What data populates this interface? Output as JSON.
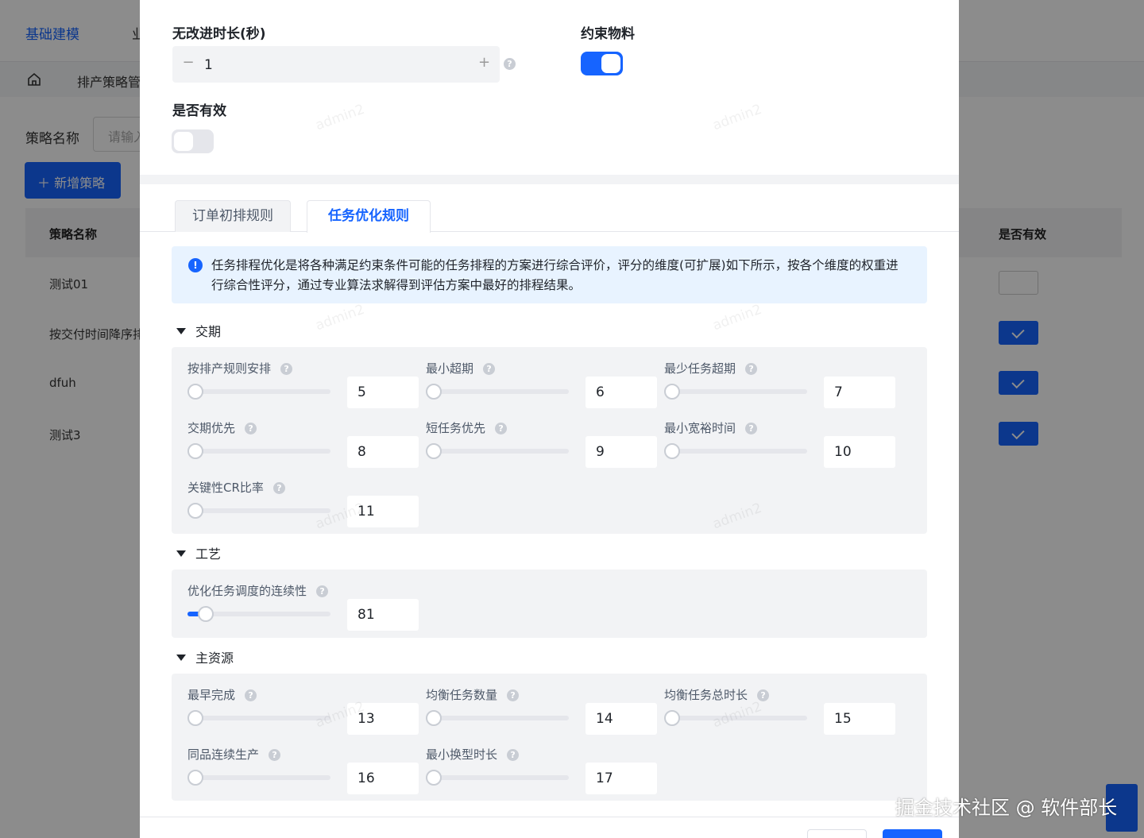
{
  "background": {
    "nav": {
      "first": "基础建模",
      "second": "业"
    },
    "breadcrumb": "排产策略管",
    "filter": {
      "label": "策略名称",
      "placeholder": "请输入"
    },
    "add_button": "新增策略",
    "table": {
      "headers": {
        "name": "策略名称",
        "valid": "是否有效"
      },
      "rows": [
        {
          "name": "测试01",
          "valid": false
        },
        {
          "name": "按交付时间降序排",
          "valid": true
        },
        {
          "name": "dfuh",
          "valid": true
        },
        {
          "name": "测试3",
          "valid": true
        }
      ]
    }
  },
  "modal": {
    "no_improve": {
      "label": "无改进时长(秒)",
      "value": "1",
      "minus": "−",
      "plus": "+"
    },
    "constrain_material": {
      "label": "约束物料",
      "on": true
    },
    "is_valid": {
      "label": "是否有效",
      "on": false
    },
    "tabs": [
      {
        "label": "订单初排规则",
        "active": false
      },
      {
        "label": "任务优化规则",
        "active": true
      }
    ],
    "info": "任务排程优化是将各种满足约束条件可能的任务排程的方案进行综合评价，评分的维度(可扩展)如下所示，按各个维度的权重进行综合性评分，通过专业算法求解得到评估方案中最好的排程结果。",
    "groups": [
      {
        "title": "交期",
        "items": [
          {
            "label": "按排产规则安排",
            "value": "5",
            "percent": 0
          },
          {
            "label": "最小超期",
            "value": "6",
            "percent": 0
          },
          {
            "label": "最少任务超期",
            "value": "7",
            "percent": 0
          },
          {
            "label": "交期优先",
            "value": "8",
            "percent": 0
          },
          {
            "label": "短任务优先",
            "value": "9",
            "percent": 0
          },
          {
            "label": "最小宽裕时间",
            "value": "10",
            "percent": 0
          },
          {
            "label": "关键性CR比率",
            "value": "11",
            "percent": 0
          }
        ]
      },
      {
        "title": "工艺",
        "items": [
          {
            "label": "优化任务调度的连续性",
            "value": "81",
            "percent": 8
          }
        ]
      },
      {
        "title": "主资源",
        "items": [
          {
            "label": "最早完成",
            "value": "13",
            "percent": 0
          },
          {
            "label": "均衡任务数量",
            "value": "14",
            "percent": 0
          },
          {
            "label": "均衡任务总时长",
            "value": "15",
            "percent": 0
          },
          {
            "label": "同品连续生产",
            "value": "16",
            "percent": 0
          },
          {
            "label": "最小换型时长",
            "value": "17",
            "percent": 0
          }
        ]
      }
    ],
    "help_glyph": "?",
    "info_glyph": "!",
    "watermark": "admin2"
  },
  "corner_watermark": "掘金技术社区 @ 软件部长",
  "colors": {
    "primary": "#1664ff",
    "panel": "#f2f3f5",
    "info_bg": "#e8f3ff"
  }
}
